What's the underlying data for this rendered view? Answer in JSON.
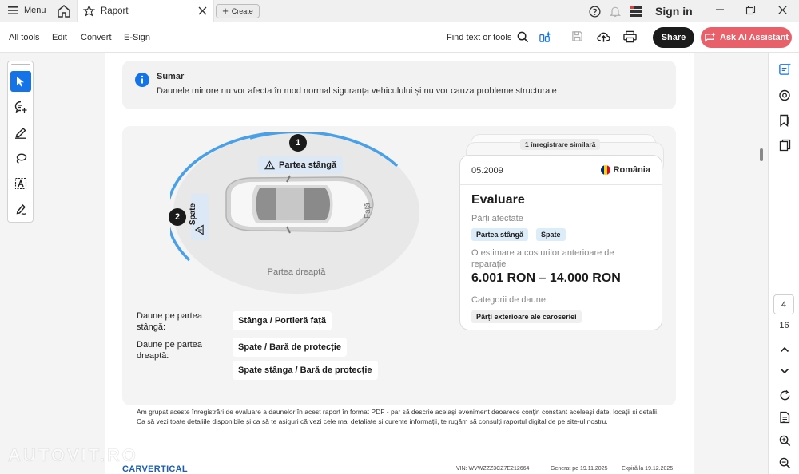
{
  "tabbar": {
    "menu_label": "Menu",
    "tab_title": "Raport",
    "create_label": "Create",
    "sign_in_label": "Sign in"
  },
  "toolbar": {
    "all_tools": "All tools",
    "edit": "Edit",
    "convert": "Convert",
    "esign": "E-Sign",
    "find_text": "Find text or tools",
    "share": "Share",
    "ask_ai": "Ask AI Assistant"
  },
  "summary": {
    "title": "Sumar",
    "text": "Daunele minore nu vor afecta în mod normal siguranța vehiculului și nu vor cauza probleme structurale"
  },
  "diagram": {
    "marker_1": "1",
    "marker_2": "2",
    "left_side_label": "Partea stângă",
    "rear_label": "Spate",
    "front_label": "Față",
    "right_side_label": "Partea dreaptă"
  },
  "damages": {
    "left_label": "Daune pe partea stângă:",
    "left_value": "Stânga / Portieră față",
    "right_label": "Daune pe partea dreaptă:",
    "right_values": [
      "Spate / Bară de protecție",
      "Spate stânga / Bară de protecție"
    ]
  },
  "record": {
    "similar": "1 înregistrare similară",
    "date": "05.2009",
    "country": "România",
    "title": "Evaluare",
    "affected_label": "Părți afectate",
    "affected_tags": [
      "Partea stângă",
      "Spate"
    ],
    "cost_label": "O estimare a costurilor anterioare de reparație",
    "cost_value": "6.001 RON – 14.000 RON",
    "category_label": "Categorii de daune",
    "category_tag": "Părți exterioare ale caroseriei"
  },
  "footnote": {
    "line1": "Am grupat aceste înregistrări de evaluare a daunelor în acest raport în format PDF - par să descrie același eveniment deoarece conțin constant aceleași date, locații și detalii.",
    "line2": "Ca să vezi toate detaliile disponibile și ca să te asiguri că vezi cele mai detaliate și curente informații, te rugăm să consulți raportul digital de pe site-ul nostru."
  },
  "footer": {
    "brand": "CARVERTICAL",
    "vin": "VIN:  WVWZZZ3CZ7E212664",
    "generated": "Generat pe  19.11.2025",
    "expires": "Expiră la  19.12.2025",
    "watermark": "AUTOVIT.RO"
  },
  "pages": {
    "current": "4",
    "total": "16"
  },
  "colors": {
    "accent_blue": "#1473e6",
    "ai_button": "#e8616a",
    "arc_blue": "#4aa0e6",
    "tag_bg": "#dcecf8"
  }
}
